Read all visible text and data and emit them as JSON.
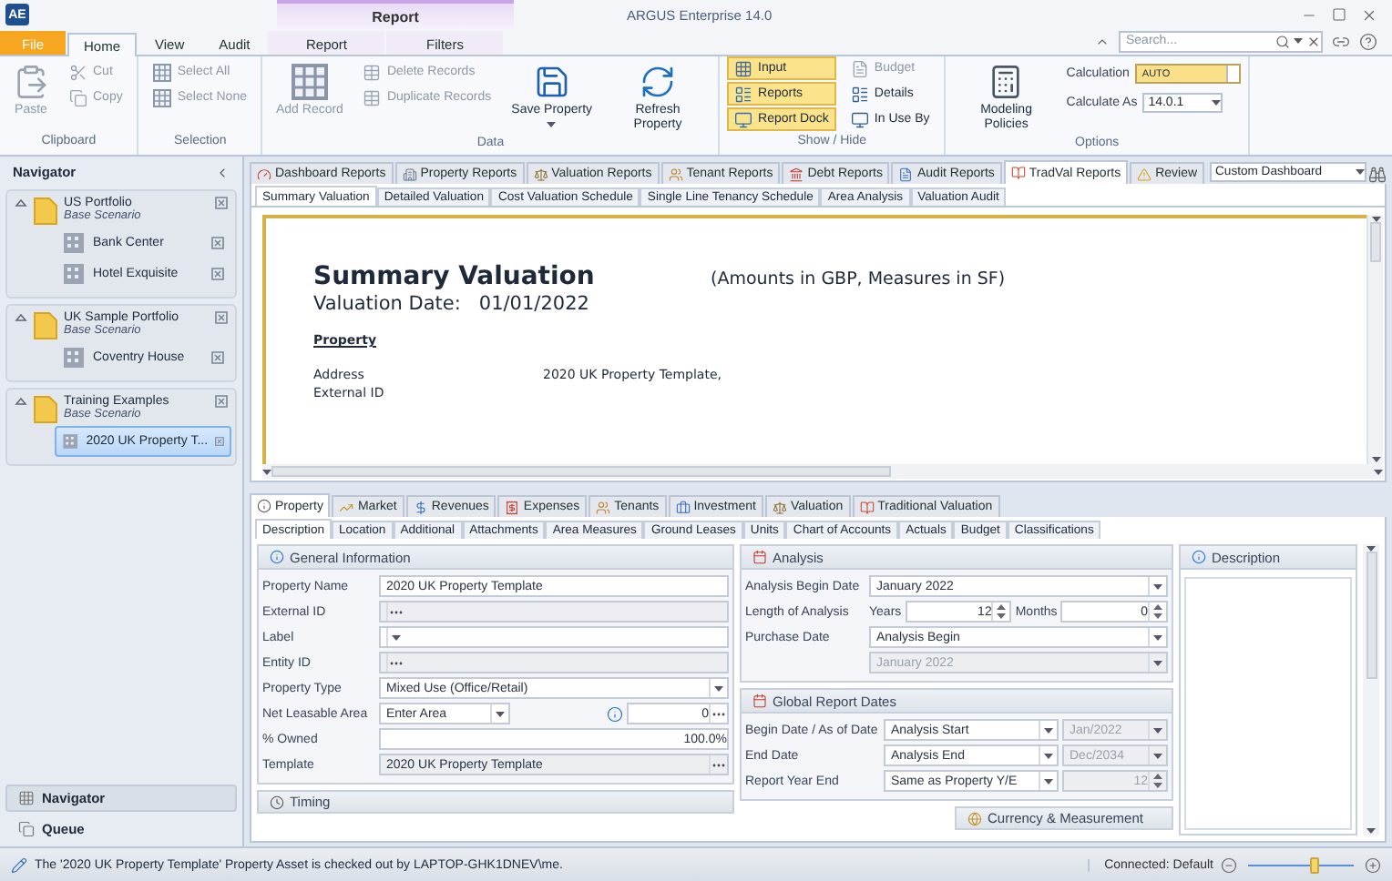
{
  "window": {
    "logo": "AE",
    "context_tab": "Report",
    "title": "ARGUS Enterprise 14.0"
  },
  "ribbon_tabs": [
    {
      "label": "File",
      "kind": "file",
      "selected": false
    },
    {
      "label": "Home",
      "kind": "normal",
      "selected": true
    },
    {
      "label": "View",
      "kind": "normal",
      "selected": false
    },
    {
      "label": "Audit",
      "kind": "normal",
      "selected": false
    },
    {
      "label": "Report",
      "kind": "context",
      "selected": false
    },
    {
      "label": "Filters",
      "kind": "context",
      "selected": false
    }
  ],
  "search": {
    "placeholder": "Search..."
  },
  "ribbon_groups": [
    {
      "label": "Clipboard",
      "columns": [
        [
          {
            "label": "Paste",
            "kind": "large",
            "disabled": true
          }
        ],
        [
          {
            "label": "Cut",
            "kind": "small",
            "disabled": true
          },
          {
            "label": "Copy",
            "kind": "small",
            "disabled": true
          }
        ]
      ]
    },
    {
      "label": "Selection",
      "columns": [
        [
          {
            "label": "Select All",
            "kind": "small",
            "disabled": true
          },
          {
            "label": "Select None",
            "kind": "small",
            "disabled": true
          }
        ]
      ]
    },
    {
      "label": "Data",
      "columns": [
        [
          {
            "label": "Add Record",
            "kind": "large",
            "disabled": true
          }
        ],
        [
          {
            "label": "Delete Records",
            "kind": "small",
            "disabled": true
          },
          {
            "label": "Duplicate Records",
            "kind": "small",
            "disabled": true
          }
        ],
        [
          {
            "label": "Save Property",
            "kind": "split",
            "disabled": false
          }
        ],
        [
          {
            "label": "Refresh Property",
            "kind": "large",
            "disabled": false
          }
        ]
      ]
    },
    {
      "label": "Show / Hide",
      "columns": [
        [
          {
            "label": "Input",
            "kind": "toggle",
            "on": true,
            "disabled": false
          },
          {
            "label": "Reports",
            "kind": "toggle",
            "on": true,
            "disabled": false
          },
          {
            "label": "Report Dock",
            "kind": "toggle",
            "on": true,
            "disabled": false
          }
        ],
        [
          {
            "label": "Budget",
            "kind": "toggle",
            "on": false,
            "disabled": true
          },
          {
            "label": "Details",
            "kind": "toggle",
            "on": false,
            "disabled": false
          },
          {
            "label": "In Use By",
            "kind": "toggle",
            "on": false,
            "disabled": false
          }
        ]
      ]
    },
    {
      "label": "Options",
      "columns": [
        [
          {
            "label": "Modeling Policies",
            "kind": "large",
            "disabled": false
          }
        ],
        [
          {
            "label": "Calculation",
            "kind": "switch",
            "value": "AUTO",
            "on": true
          },
          {
            "label": "Calculate As",
            "kind": "combo",
            "value": "14.0.1"
          }
        ]
      ]
    }
  ],
  "navigator": {
    "title": "Navigator",
    "portfolios": [
      {
        "name": "US Portfolio",
        "scenario": "Base Scenario",
        "expanded": true,
        "children": [
          {
            "name": "Bank Center",
            "selected": false
          },
          {
            "name": "Hotel Exquisite",
            "selected": false
          }
        ]
      },
      {
        "name": "UK Sample Portfolio",
        "scenario": "Base Scenario",
        "expanded": true,
        "children": [
          {
            "name": "Coventry House",
            "selected": false
          }
        ]
      },
      {
        "name": "Training Examples",
        "scenario": "Base Scenario",
        "expanded": true,
        "children": [
          {
            "name": "2020 UK Property T...",
            "selected": true
          }
        ]
      }
    ],
    "panes": [
      {
        "label": "Navigator",
        "selected": true
      },
      {
        "label": "Queue",
        "selected": false
      }
    ]
  },
  "report_tabs": [
    {
      "label": "Dashboard Reports",
      "selected": false
    },
    {
      "label": "Property Reports",
      "selected": false
    },
    {
      "label": "Valuation Reports",
      "selected": false
    },
    {
      "label": "Tenant Reports",
      "selected": false
    },
    {
      "label": "Debt Reports",
      "selected": false
    },
    {
      "label": "Audit Reports",
      "selected": false
    },
    {
      "label": "TradVal Reports",
      "selected": true
    },
    {
      "label": "Review",
      "selected": false
    }
  ],
  "dashboard_select": {
    "value": "Custom Dashboard"
  },
  "report_subtabs": [
    {
      "label": "Summary Valuation",
      "selected": true
    },
    {
      "label": "Detailed Valuation",
      "selected": false
    },
    {
      "label": "Cost Valuation Schedule",
      "selected": false
    },
    {
      "label": "Single Line Tenancy Schedule",
      "selected": false
    },
    {
      "label": "Area Analysis",
      "selected": false
    },
    {
      "label": "Valuation Audit",
      "selected": false
    }
  ],
  "report": {
    "title": "Summary Valuation",
    "units": "(Amounts in GBP, Measures in SF)",
    "date_label": "Valuation Date:",
    "date": "01/01/2022",
    "section": "Property",
    "rows": [
      {
        "label": "Address",
        "value": "2020 UK Property Template,"
      },
      {
        "label": "External ID"
      }
    ]
  },
  "input_tabs": [
    {
      "label": "Property",
      "selected": true
    },
    {
      "label": "Market",
      "selected": false
    },
    {
      "label": "Revenues",
      "selected": false
    },
    {
      "label": "Expenses",
      "selected": false
    },
    {
      "label": "Tenants",
      "selected": false
    },
    {
      "label": "Investment",
      "selected": false
    },
    {
      "label": "Valuation",
      "selected": false
    },
    {
      "label": "Traditional Valuation",
      "selected": false
    }
  ],
  "input_subtabs": [
    {
      "label": "Description",
      "selected": true
    },
    {
      "label": "Location",
      "selected": false
    },
    {
      "label": "Additional",
      "selected": false
    },
    {
      "label": "Attachments",
      "selected": false
    },
    {
      "label": "Area Measures",
      "selected": false
    },
    {
      "label": "Ground Leases",
      "selected": false
    },
    {
      "label": "Units",
      "selected": false
    },
    {
      "label": "Chart of Accounts",
      "selected": false
    },
    {
      "label": "Actuals",
      "selected": false
    },
    {
      "label": "Budget",
      "selected": false
    },
    {
      "label": "Classifications",
      "selected": false
    }
  ],
  "general_information": {
    "title": "General Information",
    "fields": [
      {
        "label": "Property Name",
        "kind": "text",
        "value": "2020 UK Property Template",
        "disabled": false
      },
      {
        "label": "External ID",
        "kind": "browse",
        "disabled": true
      },
      {
        "label": "Label",
        "kind": "combo",
        "disabled": false
      },
      {
        "label": "Entity ID",
        "kind": "browse",
        "disabled": true
      },
      {
        "label": "Property Type",
        "kind": "combo",
        "value": "Mixed Use (Office/Retail)",
        "disabled": false
      },
      {
        "label": "Net Leasable Area",
        "kind": "area",
        "value": "Enter Area",
        "amount": "0",
        "disabled": false
      },
      {
        "label": "% Owned",
        "kind": "number",
        "value": "100.0%",
        "disabled": false
      },
      {
        "label": "Template",
        "kind": "browse",
        "value": "2020 UK Property Template",
        "disabled": true
      }
    ]
  },
  "analysis": {
    "title": "Analysis",
    "fields": [
      {
        "label": "Analysis Begin Date",
        "kind": "combo",
        "value": "January 2022",
        "disabled": false
      },
      {
        "label": "Length of Analysis",
        "kind": "length",
        "years_label": "Years",
        "years": "12",
        "months_label": "Months",
        "months": "0",
        "disabled": false
      },
      {
        "label": "Purchase Date",
        "kind": "combo",
        "value": "Analysis Begin",
        "disabled": false
      },
      {
        "kind": "combo",
        "value": "January 2022",
        "disabled": true
      }
    ]
  },
  "global_report_dates": {
    "title": "Global Report Dates",
    "fields": [
      {
        "label": "Begin Date / As of Date",
        "value": "Analysis Start",
        "second": "Jan/2022",
        "kind": "combo"
      },
      {
        "label": "End Date",
        "value": "Analysis End",
        "second": "Dec/2034",
        "kind": "combo"
      },
      {
        "label": "Report Year End",
        "value": "Same as Property Y/E",
        "second": "12",
        "kind": "spin"
      }
    ]
  },
  "description": {
    "title": "Description"
  },
  "timing": {
    "title": "Timing"
  },
  "currency": {
    "title": "Currency & Measurement"
  },
  "status_bar": {
    "message": "The '2020 UK Property Template' Property Asset is checked out by LAPTOP-GHK1DNEV\\me.",
    "connection": "Connected: Default",
    "zoom": {
      "level": 0.62
    }
  }
}
